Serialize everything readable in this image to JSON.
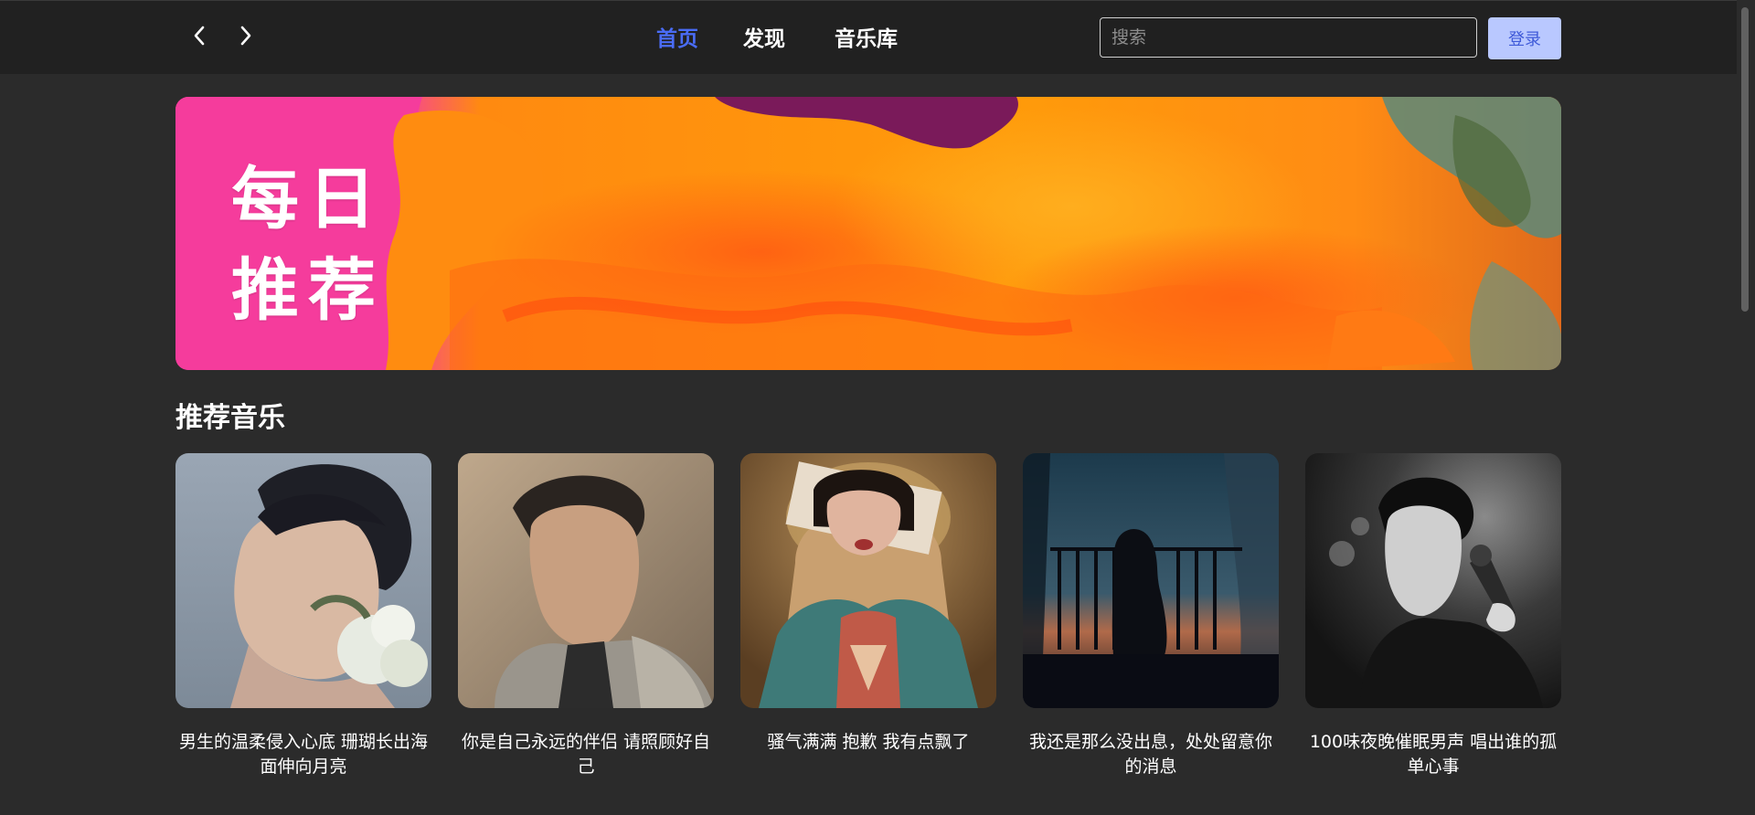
{
  "nav": {
    "back_icon": "chevron-left-icon",
    "forward_icon": "chevron-right-icon",
    "tabs": [
      {
        "label": "首页",
        "active": true
      },
      {
        "label": "发现",
        "active": false
      },
      {
        "label": "音乐库",
        "active": false
      }
    ],
    "search_placeholder": "搜索",
    "login_label": "登录"
  },
  "banner": {
    "title_line1": "每日",
    "title_line2": "推荐"
  },
  "section": {
    "title": "推荐音乐"
  },
  "playlists": [
    {
      "title": "男生的温柔侵入心底 珊瑚长出海面伸向月亮"
    },
    {
      "title": "你是自己永远的伴侣 请照顾好自己"
    },
    {
      "title": "骚气满满 抱歉 我有点飘了"
    },
    {
      "title": "我还是那么没出息，处处留意你的消息"
    },
    {
      "title": "100味夜晚催眠男声 唱出谁的孤单心事"
    }
  ],
  "colors": {
    "active_tab": "#4a6cf7",
    "login_bg": "#b9c8ff",
    "page_bg": "#2b2b2b",
    "topbar_bg": "#212121"
  }
}
